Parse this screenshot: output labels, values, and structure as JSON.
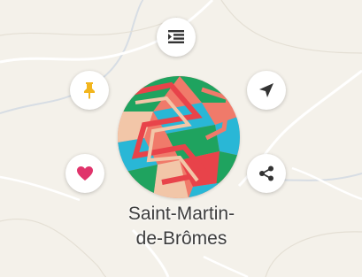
{
  "map": {
    "background_color": "#f4f1ea",
    "road_color": "#ffffff",
    "water_color": "#d7dde4",
    "contour_color": "#ded8cc"
  },
  "place": {
    "name_line1": "Saint-Martin-",
    "name_line2": "de-Brômes",
    "thumbnail_colors": [
      "#1fa35f",
      "#f07a6a",
      "#29b7d6",
      "#f2c6a8",
      "#e8434a"
    ]
  },
  "actions": [
    {
      "id": "details",
      "icon": "list-indent-icon",
      "color": "#333333"
    },
    {
      "id": "pin",
      "icon": "pin-icon",
      "color": "#f2b51d"
    },
    {
      "id": "navigate",
      "icon": "navigation-arrow-icon",
      "color": "#333333"
    },
    {
      "id": "favorite",
      "icon": "heart-icon",
      "color": "#e0336b"
    },
    {
      "id": "share",
      "icon": "share-icon",
      "color": "#333333"
    }
  ]
}
